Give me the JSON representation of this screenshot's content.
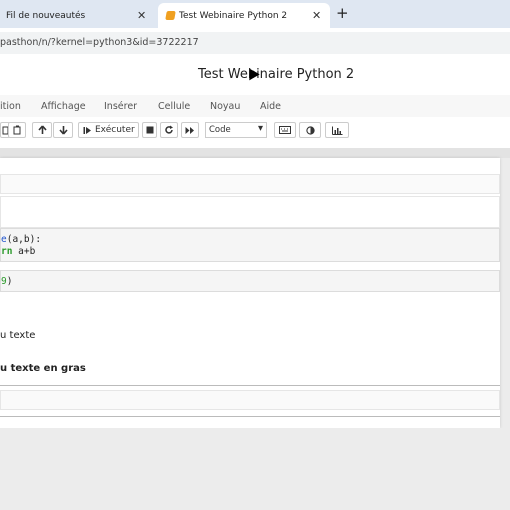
{
  "browser": {
    "tabs": [
      {
        "label": "Fil de nouveautés",
        "close": "✕"
      },
      {
        "label": "Test Webinaire Python 2",
        "close": "✕"
      }
    ],
    "new_tab": "+",
    "url": "pasthon/n/?kernel=python3&id=3722217"
  },
  "notebook": {
    "title": "Test Webinaire Python 2",
    "menu": [
      "ition",
      "Affichage",
      "Insérer",
      "Cellule",
      "Noyau",
      "Aide"
    ],
    "toolbar": {
      "run_label": "Exécuter",
      "cell_type": "Code",
      "dropdown_chevron": "▾"
    },
    "cells": {
      "code1_line1_pre": "e",
      "code1_line1_post": "(a,b):",
      "code1_line2_kw": "rn",
      "code1_line2_rest": " a+b",
      "code2_num": "9",
      "code2_rest": ")",
      "md_text": "u texte",
      "md_bold": "u texte en gras"
    }
  },
  "colors": {
    "tabbar": "#dfe7f2",
    "keyword": "#2a9a2a",
    "function": "#2255cc",
    "tab_favicon": "#f0a020"
  },
  "icons": [
    "close-icon",
    "plus-icon",
    "copy-icon",
    "paste-icon",
    "arrow-up-icon",
    "arrow-down-icon",
    "skip-next-icon",
    "stop-icon",
    "restart-icon",
    "fast-forward-icon",
    "keyboard-icon",
    "contrast-icon",
    "chart-icon",
    "mouse-cursor-icon"
  ]
}
